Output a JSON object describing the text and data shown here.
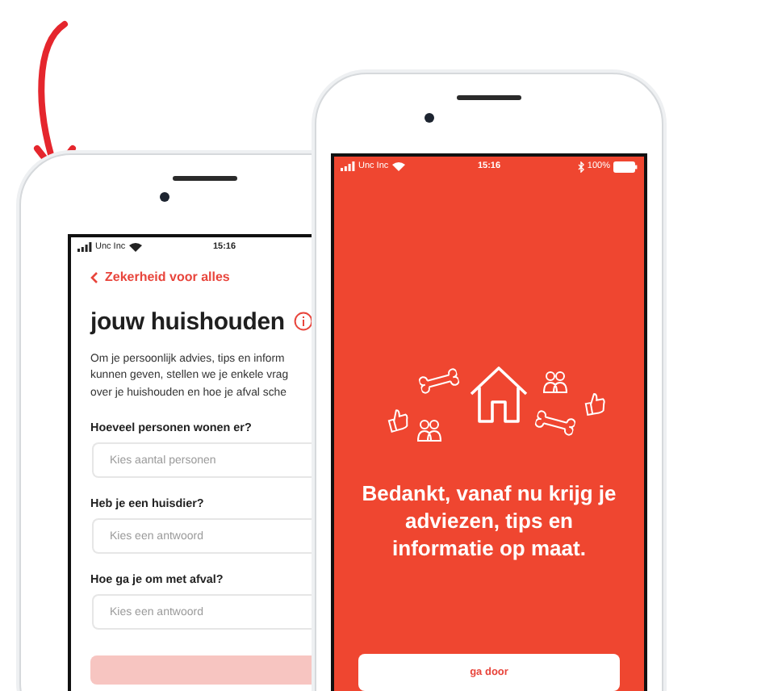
{
  "left_phone": {
    "status_bar": {
      "carrier": "Unc Inc",
      "time": "15:16"
    },
    "back_link": "Zekerheid voor alles",
    "title": "jouw huishouden",
    "intro_lines": [
      "Om je persoonlijk advies, tips en inform",
      "kunnen geven, stellen we je enkele vrag",
      "over je huishouden en hoe je afval sche"
    ],
    "questions": [
      {
        "label": "Hoeveel personen wonen er?",
        "placeholder": "Kies aantal personen"
      },
      {
        "label": "Heb je een huisdier?",
        "placeholder": "Kies een antwoord"
      },
      {
        "label": "Hoe ga je om met afval?",
        "placeholder": "Kies een antwoord"
      }
    ]
  },
  "right_phone": {
    "status_bar": {
      "carrier": "Unc Inc",
      "time": "15:16",
      "battery": "100%"
    },
    "message": "Bedankt, vanaf nu krijg je adviezen, tips en informatie op maat.",
    "button": "ga door"
  }
}
